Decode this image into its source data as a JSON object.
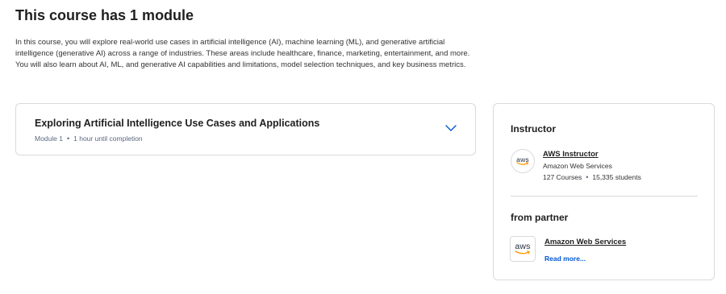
{
  "page": {
    "title": "This course has 1 module",
    "description": "In this course, you will explore real-world use cases in artificial intelligence (AI), machine learning (ML), and generative artificial intelligence (generative AI) across a range of industries. These areas include healthcare, finance, marketing, entertainment, and more. You will also learn about AI, ML, and generative AI capabilities and limitations, model selection techniques, and key business metrics."
  },
  "module": {
    "title": "Exploring Artificial Intelligence Use Cases and Applications",
    "number": "Module 1",
    "separator": "•",
    "duration": "1 hour until completion",
    "expand_icon": "chevron-down-icon"
  },
  "instructor": {
    "heading": "Instructor",
    "name": "AWS Instructor",
    "org": "Amazon Web Services",
    "courses": "127 Courses",
    "separator": "•",
    "students": "15,335 students",
    "avatar_text": "aws"
  },
  "partner": {
    "heading": "from partner",
    "name": "Amazon Web Services",
    "read_more": "Read more...",
    "logo_text": "aws"
  },
  "colors": {
    "link": "#0056d2",
    "border": "#d8dadd",
    "aws_orange": "#ff9900",
    "aws_navy": "#232f3e"
  }
}
